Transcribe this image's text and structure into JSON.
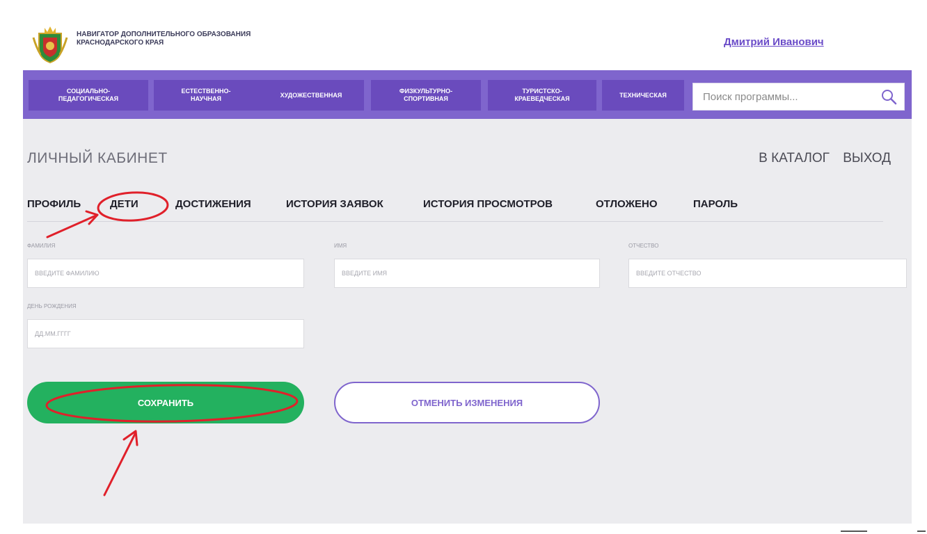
{
  "header": {
    "brand_text": "Навигатор дополнительного образования Краснодарского края",
    "user_name": "Дмитрий Иванович"
  },
  "nav": {
    "items": [
      {
        "label": "Социально-\nпедагогическая"
      },
      {
        "label": "Естественно-\nнаучная"
      },
      {
        "label": "Художественная"
      },
      {
        "label": "Физкультурно-\nспортивная"
      },
      {
        "label": "Туристско-\nкраеведческая"
      },
      {
        "label": "Техническая"
      }
    ],
    "search_placeholder": "Поиск программы..."
  },
  "page": {
    "title": "ЛИЧНЫЙ КАБИНЕТ",
    "catalog_link": "В КАТАЛОГ",
    "logout_link": "ВЫХОД"
  },
  "tabs": [
    {
      "label": "ПРОФИЛЬ"
    },
    {
      "label": "ДЕТИ"
    },
    {
      "label": "ДОСТИЖЕНИЯ"
    },
    {
      "label": "ИСТОРИЯ ЗАЯВОК"
    },
    {
      "label": "ИСТОРИЯ ПРОСМОТРОВ"
    },
    {
      "label": "ОТЛОЖЕНО"
    },
    {
      "label": "ПАРОЛЬ"
    }
  ],
  "form": {
    "surname": {
      "label": "ФАМИЛИЯ",
      "placeholder": "ВВЕДИТЕ ФАМИЛИЮ",
      "value": ""
    },
    "name": {
      "label": "ИМЯ",
      "placeholder": "ВВЕДИТЕ ИМЯ",
      "value": ""
    },
    "patronymic": {
      "label": "ОТЧЕСТВО",
      "placeholder": "ВВЕДИТЕ ОТЧЕСТВО",
      "value": ""
    },
    "birthday": {
      "label": "ДЕНЬ РОЖДЕНИЯ",
      "placeholder": "ДД.ММ.ГГГГ",
      "value": ""
    }
  },
  "buttons": {
    "save": "СОХРАНИТЬ",
    "cancel": "ОТМЕНИТЬ ИЗМЕНЕНИЯ"
  },
  "colors": {
    "nav_purple": "#7f65cd",
    "save_green": "#23b15f",
    "annotation_red": "#e0202a"
  }
}
